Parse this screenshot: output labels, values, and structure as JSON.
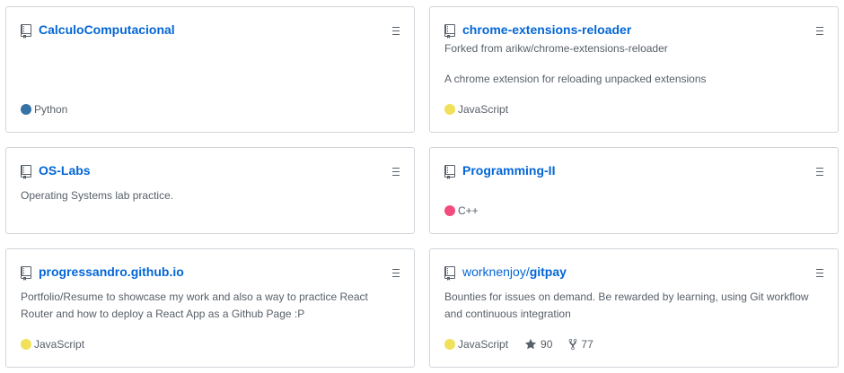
{
  "repos": [
    {
      "name": "CalculoComputacional",
      "language": "Python",
      "lang_color": "#3572A5"
    },
    {
      "name": "chrome-extensions-reloader",
      "forked_from": "Forked from arikw/chrome-extensions-reloader",
      "description": "A chrome extension for reloading unpacked extensions",
      "language": "JavaScript",
      "lang_color": "#f1e05a"
    },
    {
      "name": "OS-Labs",
      "description": "Operating Systems lab practice."
    },
    {
      "name": "Programming-II",
      "language": "C++",
      "lang_color": "#f34b7d"
    },
    {
      "name": "progressandro.github.io",
      "description_line1": "Portfolio/Resume to showcase my work and also a way to practice React",
      "description_line2": "Router and how to deploy a React App as a Github Page :P",
      "language": "JavaScript",
      "lang_color": "#f1e05a"
    },
    {
      "owner": "worknenjoy/",
      "name": "gitpay",
      "description_line1": "Bounties for issues on demand. Be rewarded by learning, using Git workflow",
      "description_line2": "and continuous integration",
      "language": "JavaScript",
      "lang_color": "#f1e05a",
      "stars": "90",
      "forks": "77"
    }
  ],
  "icons": {
    "repo": "repo-icon",
    "menu": "grabber-icon",
    "star": "star-icon",
    "fork": "fork-icon"
  }
}
